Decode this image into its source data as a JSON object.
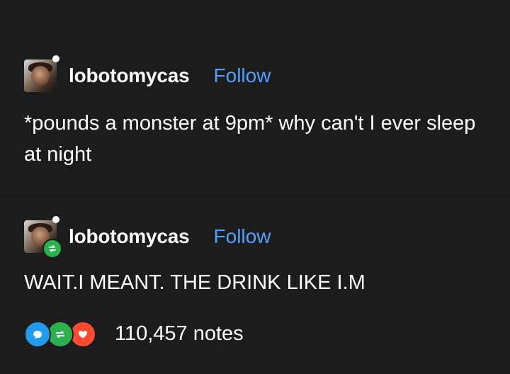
{
  "posts": [
    {
      "username": "lobotomycas",
      "follow_label": "Follow",
      "text": "*pounds a monster at 9pm* why can't I ever sleep at night"
    },
    {
      "username": "lobotomycas",
      "follow_label": "Follow",
      "text": "WAIT.I MEANT. THE DRINK LIKE I.M"
    }
  ],
  "footer": {
    "notes": "110,457 notes"
  },
  "colors": {
    "background": "#1c1c1c",
    "follow": "#4fa3ff",
    "reply": "#1f9bf0",
    "reblog": "#2bb24c",
    "like": "#ff4930"
  }
}
